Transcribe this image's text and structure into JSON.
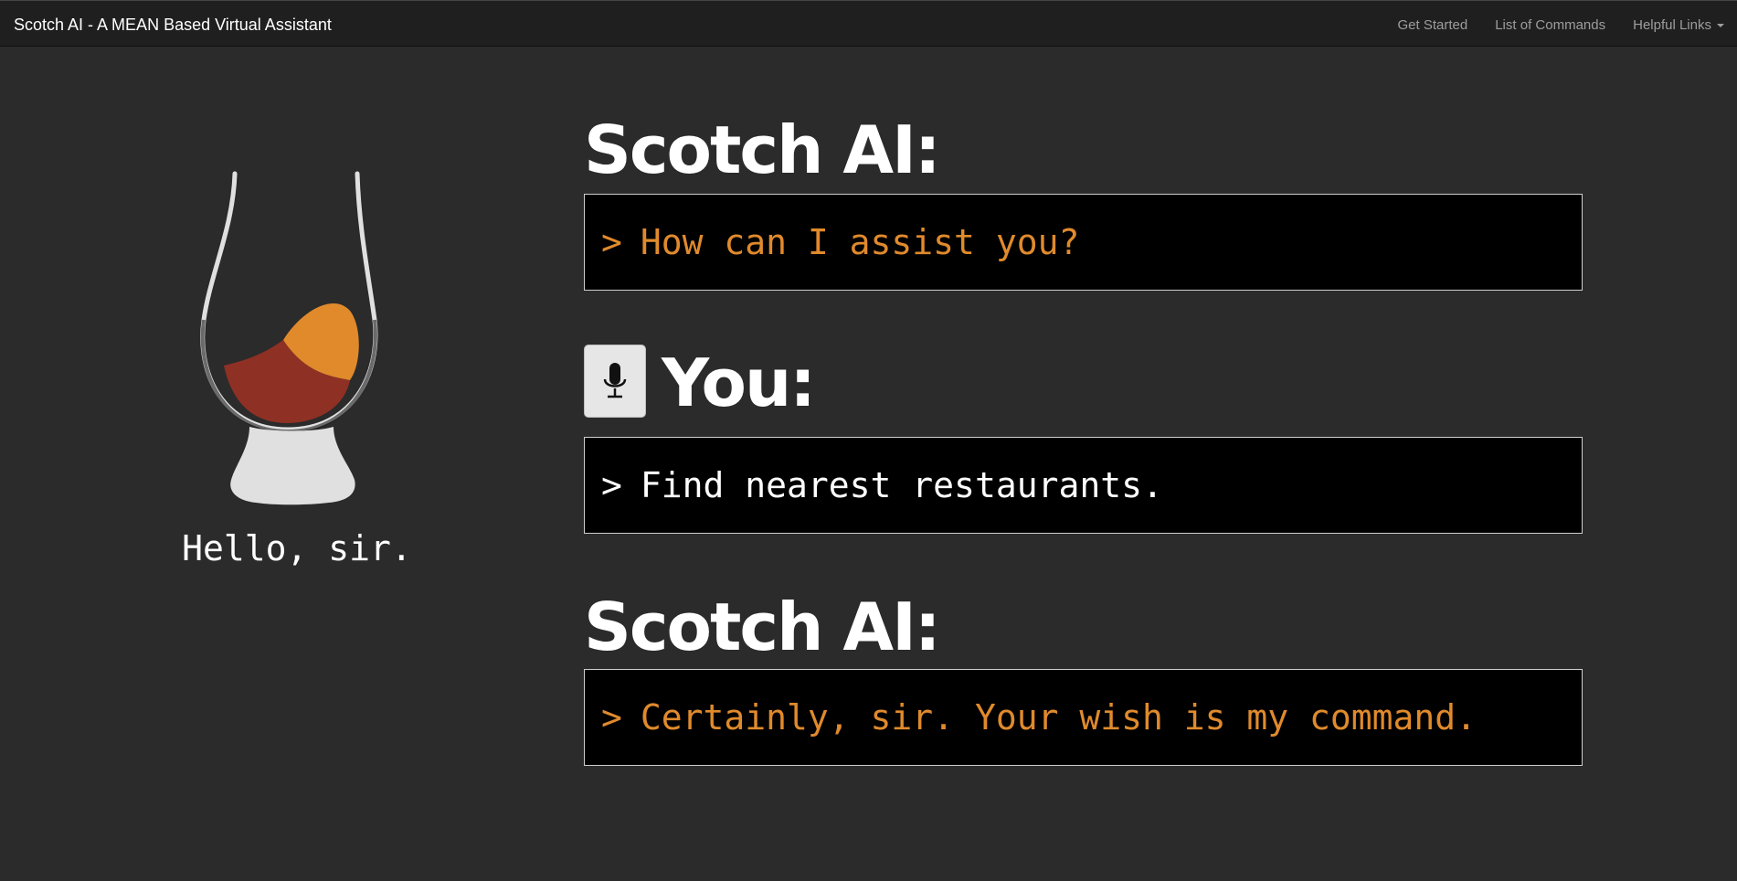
{
  "navbar": {
    "brand": "Scotch AI - A MEAN Based Virtual Assistant",
    "links": [
      "Get Started",
      "List of Commands",
      "Helpful Links"
    ]
  },
  "sidebar": {
    "logo_icon": "whisky-glass-icon",
    "greeting": "Hello, sir."
  },
  "conversation": [
    {
      "speaker": "Scotch AI:",
      "prompt": ">",
      "text": "How can I assist you?",
      "color": "#e08a2c"
    },
    {
      "speaker": "You:",
      "prompt": ">",
      "text": "Find nearest restaurants.",
      "color": "#ffffff",
      "mic_icon": "microphone-icon"
    },
    {
      "speaker": "Scotch AI:",
      "prompt": ">",
      "text": "Certainly, sir. Your wish is my command.",
      "color": "#e08a2c"
    }
  ],
  "colors": {
    "background": "#2b2b2b",
    "navbar": "#1f1f1f",
    "accent_orange": "#e08a2c",
    "liquid_red": "#8f3024",
    "glass": "#e0e0e0"
  }
}
